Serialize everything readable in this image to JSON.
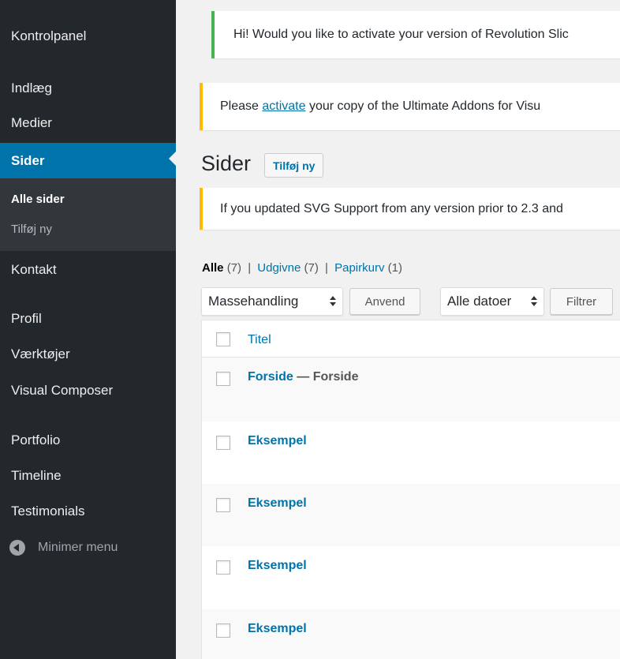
{
  "sidebar": {
    "items": [
      {
        "label": "Kontrolpanel"
      },
      {
        "label": "Indlæg"
      },
      {
        "label": "Medier"
      },
      {
        "label": "Sider"
      },
      {
        "label": "Kontakt"
      },
      {
        "label": "Profil"
      },
      {
        "label": "Værktøjer"
      },
      {
        "label": "Visual Composer"
      },
      {
        "label": "Portfolio"
      },
      {
        "label": "Timeline"
      },
      {
        "label": "Testimonials"
      }
    ],
    "submenu": [
      {
        "label": "Alle sider"
      },
      {
        "label": "Tilføj ny"
      }
    ],
    "collapse_label": "Minimer menu"
  },
  "notices": {
    "revslider": "Hi! Would you like to activate your version of Revolution Slic",
    "ultimate_before": "Please ",
    "ultimate_link": "activate",
    "ultimate_after": " your copy of the Ultimate Addons for Visu",
    "svg": "If you updated SVG Support from any version prior to 2.3 and"
  },
  "page": {
    "title": "Sider",
    "add_new": "Tilføj ny"
  },
  "filters": {
    "all": "Alle",
    "all_count": "(7)",
    "published": "Udgivne",
    "published_count": "(7)",
    "trash": "Papirkurv",
    "trash_count": "(1)",
    "sep": "|"
  },
  "toolbar": {
    "bulk_action": "Massehandling",
    "apply": "Anvend",
    "dates": "Alle datoer",
    "filter": "Filtrer"
  },
  "table": {
    "column_title": "Titel",
    "rows": [
      {
        "title": "Forside",
        "state": " — Forside"
      },
      {
        "title": "Eksempel",
        "state": ""
      },
      {
        "title": "Eksempel",
        "state": ""
      },
      {
        "title": "Eksempel",
        "state": ""
      },
      {
        "title": "Eksempel",
        "state": ""
      }
    ]
  },
  "colors": {
    "sidebar_bg": "#23282d",
    "accent": "#0073aa",
    "notice_success": "#46b450",
    "notice_warning": "#ffb900"
  }
}
